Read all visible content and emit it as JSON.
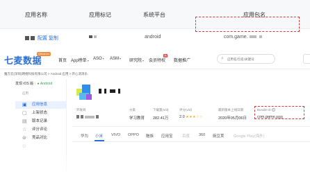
{
  "table": {
    "headers": [
      "应用名称",
      "应用标记",
      "系统平台",
      "应用包名"
    ],
    "row": {
      "name_label": "配置 复制",
      "platform": "android",
      "package": "com.game."
    }
  },
  "app": {
    "logo": "七麦数据",
    "logo_badge": "Qimai.cn",
    "nav": [
      {
        "label": "首页",
        "caret": ""
      },
      {
        "label": "App榜单",
        "caret": "▾"
      },
      {
        "label": "ASO",
        "caret": "▾"
      },
      {
        "label": "ASM",
        "caret": "▾"
      },
      {
        "label": "研究院",
        "caret": "▾"
      },
      {
        "label": "会员特权",
        "caret": ""
      },
      {
        "label": "数据推广",
        "caret": ""
      }
    ],
    "hot_badge": "热",
    "search": {
      "placeholder": "应用名/包名/关键词",
      "icon": "search-icon"
    },
    "breadcrumb": "魔方云(深圳)网络科技有限公司 > Android 应用 > 开心消消乐",
    "platform_toggle": {
      "ios": "发现 iOS 版",
      "android": "Android"
    },
    "sidebar": {
      "section": "应用",
      "items": [
        {
          "label": "应用信息",
          "icon": "info-icon",
          "active": true
        },
        {
          "label": "上架状态",
          "icon": "status-icon",
          "active": false
        },
        {
          "label": "版本记录",
          "icon": "record-icon",
          "active": false
        },
        {
          "label": "评分评论",
          "icon": "comment-icon",
          "active": false
        },
        {
          "label": "竞品对比",
          "icon": "compare-icon",
          "active": false
        },
        {
          "label": "",
          "icon": "faded-icon",
          "active": false
        }
      ]
    },
    "info": {
      "developer_label": "开发商",
      "category_label": "分类",
      "category_value": "学习教育",
      "downloads_label": "下载量(v/d)",
      "downloads_value": "282.41万",
      "rating_label": "评分(v/d)",
      "rating_value": "2.0",
      "stars": "★★★☆☆",
      "release_label": "最新版本上线日期",
      "release_value": "2020年05月06日",
      "bundle_label": "Bundle ID",
      "bundle_value": "com.game."
    },
    "store_tabs": [
      "华为",
      "小米",
      "VIVO",
      "OPPO",
      "魅族",
      "应用宝",
      "百度",
      "360",
      "豌豆荚",
      "Google Play(海外)"
    ],
    "active_tab": "小米"
  },
  "colors": {
    "accent": "#2b6fd6",
    "highlight_box": "#d6383e",
    "android_green": "#3aa55c",
    "star": "#f5a623"
  }
}
